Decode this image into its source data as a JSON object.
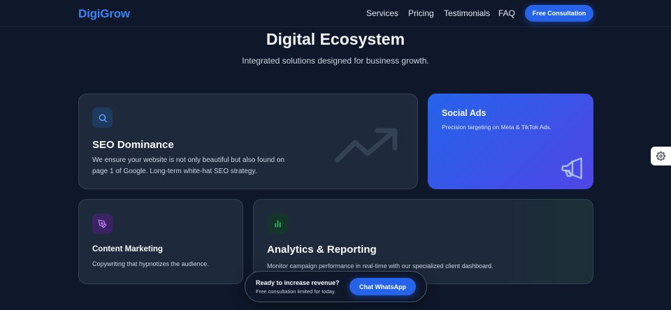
{
  "nav": {
    "logo": "DigiGrow",
    "links": [
      "Services",
      "Pricing",
      "Testimonials",
      "FAQ"
    ],
    "cta": "Free Consultation"
  },
  "hero": {
    "title": "Digital Ecosystem",
    "subtitle": "Integrated solutions designed for business growth."
  },
  "cards": {
    "seo": {
      "icon": "search-icon",
      "title": "SEO Dominance",
      "desc": "We ensure your website is not only beautiful but also found on page 1 of Google. Long-term white-hat SEO strategy.",
      "decor_icon": "trend-up-icon"
    },
    "social": {
      "title": "Social Ads",
      "desc": "Precision targeting on Meta & TikTok Ads.",
      "decor_icon": "megaphone-icon"
    },
    "content": {
      "icon": "pen-tool-icon",
      "title": "Content Marketing",
      "desc": "Copywriting that hypnotizes the audience."
    },
    "analytics": {
      "icon": "bar-chart-icon",
      "title": "Analytics & Reporting",
      "desc": "Monitor campaign performance in real-time with our specialized client dashboard."
    }
  },
  "bottom_bar": {
    "title": "Ready to increase revenue?",
    "subtitle": "Free consultation limited for today.",
    "button": "Chat WhatsApp"
  },
  "colors": {
    "background": "#0f172a",
    "card": "#1e293b",
    "accent": "#2563eb",
    "logo": "#3b82f6",
    "social_gradient_end": "#4f46e5",
    "content_icon": "#a855f7",
    "analytics_icon": "#22c55e"
  }
}
